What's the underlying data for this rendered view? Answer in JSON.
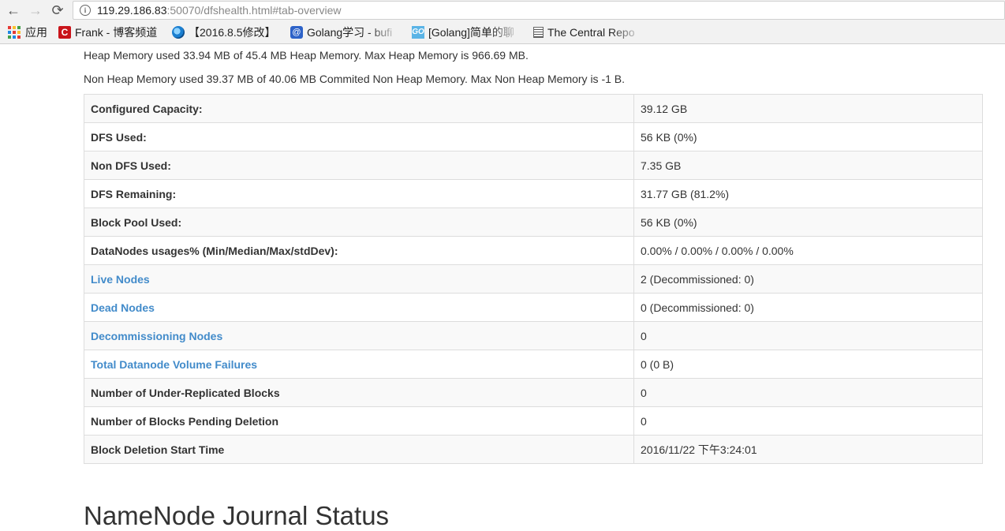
{
  "browser": {
    "url_host": "119.29.186.83",
    "url_rest": ":50070/dfshealth.html#tab-overview",
    "back_glyph": "←",
    "forward_glyph": "→",
    "reload_glyph": "⟳"
  },
  "bookmarks": [
    {
      "label": "应用",
      "icon": "apps-grid-icon"
    },
    {
      "label": "Frank - 博客频道",
      "icon": "csdn-icon"
    },
    {
      "label": "【2016.8.5修改】",
      "icon": "swirl-icon"
    },
    {
      "label": "Golang学习 - bufi",
      "icon": "blue-globe-icon"
    },
    {
      "label": "[Golang]简单的聊",
      "icon": "go-icon"
    },
    {
      "label": "The Central Repo",
      "icon": "document-icon"
    }
  ],
  "memory": {
    "heap": "Heap Memory used 33.94 MB of 45.4 MB Heap Memory. Max Heap Memory is 966.69 MB.",
    "nonheap": "Non Heap Memory used 39.37 MB of 40.06 MB Commited Non Heap Memory. Max Non Heap Memory is -1 B."
  },
  "overview": [
    {
      "key": "Configured Capacity:",
      "value": "39.12 GB",
      "link": false
    },
    {
      "key": "DFS Used:",
      "value": "56 KB (0%)",
      "link": false
    },
    {
      "key": "Non DFS Used:",
      "value": "7.35 GB",
      "link": false
    },
    {
      "key": "DFS Remaining:",
      "value": "31.77 GB (81.2%)",
      "link": false
    },
    {
      "key": "Block Pool Used:",
      "value": "56 KB (0%)",
      "link": false
    },
    {
      "key": "DataNodes usages% (Min/Median/Max/stdDev):",
      "value": "0.00% / 0.00% / 0.00% / 0.00%",
      "link": false
    },
    {
      "key": "Live Nodes",
      "value": "2 (Decommissioned: 0)",
      "link": true
    },
    {
      "key": "Dead Nodes",
      "value": "0 (Decommissioned: 0)",
      "link": true
    },
    {
      "key": "Decommissioning Nodes",
      "value": "0",
      "link": true
    },
    {
      "key": "Total Datanode Volume Failures",
      "value": "0 (0 B)",
      "link": true
    },
    {
      "key": "Number of Under-Replicated Blocks",
      "value": "0",
      "link": false
    },
    {
      "key": "Number of Blocks Pending Deletion",
      "value": "0",
      "link": false
    },
    {
      "key": "Block Deletion Start Time",
      "value": "2016/11/22 下午3:24:01",
      "link": false
    }
  ],
  "journal_heading": "NameNode Journal Status"
}
